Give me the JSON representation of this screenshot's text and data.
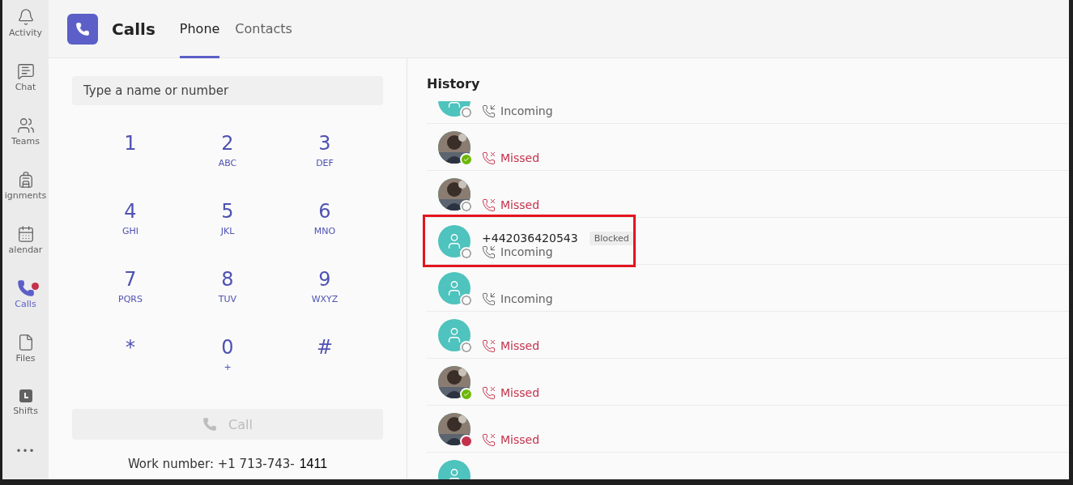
{
  "rail": [
    {
      "label": "Activity",
      "kind": "bell",
      "selected": false,
      "badge": false
    },
    {
      "label": "Chat",
      "kind": "chat",
      "selected": false,
      "badge": false
    },
    {
      "label": "Teams",
      "kind": "teams",
      "selected": false,
      "badge": false
    },
    {
      "label": "ignments",
      "kind": "backpack",
      "selected": false,
      "badge": false
    },
    {
      "label": "alendar",
      "kind": "calendar",
      "selected": false,
      "badge": false
    },
    {
      "label": "Calls",
      "kind": "phone",
      "selected": true,
      "badge": true
    },
    {
      "label": "Files",
      "kind": "file",
      "selected": false,
      "badge": false
    },
    {
      "label": "Shifts",
      "kind": "shifts",
      "selected": false,
      "badge": false
    }
  ],
  "rail_more": "•••",
  "header": {
    "title": "Calls",
    "tabs": [
      {
        "label": "Phone",
        "selected": true
      },
      {
        "label": "Contacts",
        "selected": false
      }
    ]
  },
  "dialpad": {
    "search": {
      "placeholder": "Type a name or number"
    },
    "keys": [
      {
        "digit": "1"
      },
      {
        "digit": "2",
        "letters": "ABC"
      },
      {
        "digit": "3",
        "letters": "DEF"
      },
      {
        "digit": "4",
        "letters": "GHI"
      },
      {
        "digit": "5",
        "letters": "JKL"
      },
      {
        "digit": "6",
        "letters": "MNO"
      },
      {
        "digit": "7",
        "letters": "PQRS"
      },
      {
        "digit": "8",
        "letters": "TUV"
      },
      {
        "digit": "9",
        "letters": "WXYZ"
      },
      {
        "digit": "*"
      },
      {
        "digit": "0",
        "letters": "+"
      },
      {
        "digit": "#"
      }
    ],
    "call_button": {
      "label": "Call",
      "disabled": true
    },
    "work_number_label": "Work number: +1 713-743-",
    "work_number_suffix": "1411"
  },
  "history": {
    "title": "History",
    "rows": [
      {
        "kind": "incoming",
        "avatar": {
          "kind": "default"
        },
        "presence": {
          "kind": "offline"
        },
        "label": "Incoming",
        "highlighted": false
      },
      {
        "kind": "missed",
        "presence": {
          "kind": "available"
        },
        "label": "Missed",
        "highlighted": false
      },
      {
        "kind": "missed",
        "presence": {
          "kind": "offline"
        },
        "label": "Missed",
        "highlighted": false
      },
      {
        "kind": "incoming",
        "avatar": {
          "kind": "default"
        },
        "presence": {
          "kind": "offline"
        },
        "label": "Incoming",
        "number": "+442036420543",
        "tag": "Blocked",
        "highlighted": true
      },
      {
        "kind": "incoming",
        "avatar": {
          "kind": "default"
        },
        "presence": {
          "kind": "offline"
        },
        "label": "Incoming",
        "highlighted": false
      },
      {
        "kind": "missed",
        "avatar": {
          "kind": "default"
        },
        "presence": {
          "kind": "offline"
        },
        "label": "Missed",
        "highlighted": false
      },
      {
        "kind": "missed",
        "presence": {
          "kind": "available"
        },
        "label": "Missed",
        "highlighted": false
      },
      {
        "kind": "missed",
        "presence": {
          "kind": "busy"
        },
        "label": "Missed",
        "highlighted": false
      },
      {
        "kind": "blank",
        "avatar": {
          "kind": "default"
        }
      }
    ]
  }
}
